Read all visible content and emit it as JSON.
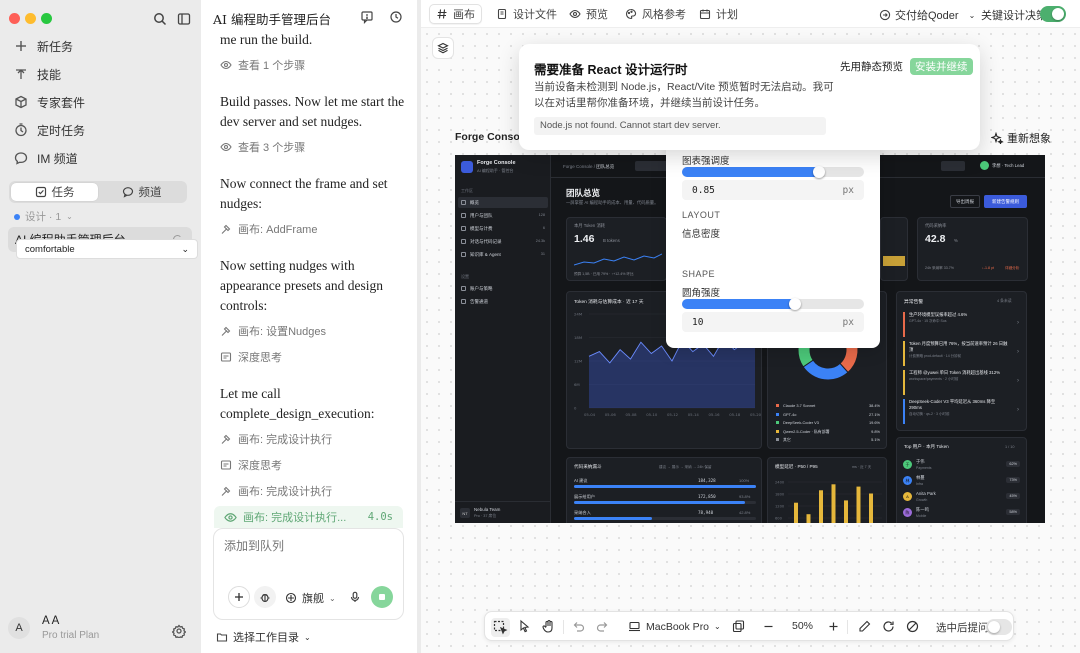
{
  "sidebar": {
    "nav": [
      {
        "label": "新任务",
        "icon": "plus-icon"
      },
      {
        "label": "技能",
        "icon": "tools-icon"
      },
      {
        "label": "专家套件",
        "icon": "package-icon"
      },
      {
        "label": "定时任务",
        "icon": "timer-icon"
      },
      {
        "label": "IM 频道",
        "icon": "chat-bubble-icon"
      }
    ],
    "segments": [
      "任务",
      "频道"
    ],
    "group_label": "设计 · 1",
    "session_title": "AI 编程助手管理后台",
    "user_avatar": "A",
    "user_name": "A A",
    "user_plan": "Pro trial Plan"
  },
  "chat": {
    "title": "AI 编程助手管理后台",
    "items": [
      {
        "type": "text",
        "text": "me run the build."
      },
      {
        "type": "step",
        "icon": "eye-icon",
        "text": "查看 1 个步骤"
      },
      {
        "type": "text",
        "text": "Build passes. Now let me start the dev server and set nudges."
      },
      {
        "type": "step",
        "icon": "eye-icon",
        "text": "查看 3 个步骤"
      },
      {
        "type": "text",
        "text": "Now connect the frame and set nudges:"
      },
      {
        "type": "step",
        "icon": "hammer-icon",
        "text": "画布: AddFrame"
      },
      {
        "type": "text",
        "text": "Now setting nudges with appearance presets and design controls:"
      },
      {
        "type": "step",
        "icon": "hammer-icon",
        "text": "画布: 设置Nudges"
      },
      {
        "type": "step",
        "icon": "thinking-icon",
        "text": "深度思考"
      },
      {
        "type": "text",
        "text": "Let me call complete_design_execution:"
      },
      {
        "type": "step",
        "icon": "hammer-icon",
        "text": "画布: 完成设计执行"
      },
      {
        "type": "step",
        "icon": "thinking-icon",
        "text": "深度思考"
      },
      {
        "type": "step",
        "icon": "hammer-icon",
        "text": "画布: 完成设计执行"
      }
    ],
    "running": {
      "label": "画布: 完成设计执行...",
      "time": "4.0s"
    },
    "composer_placeholder": "添加到队列",
    "model": "旗舰",
    "workspace": "选择工作目录"
  },
  "canvas": {
    "tabs": [
      {
        "label": "画布",
        "icon": "hash-icon",
        "active": true
      },
      {
        "label": "设计文件",
        "icon": "file-icon",
        "active": false
      },
      {
        "label": "预览",
        "icon": "eye-icon",
        "active": false
      },
      {
        "label": "风格参考",
        "icon": "palette-icon",
        "active": false
      },
      {
        "label": "计划",
        "icon": "calendar-icon",
        "active": false
      }
    ],
    "handoff": "交付给Qoder",
    "key_decisions_label": "关键设计决策",
    "key_decisions_on": true,
    "frame_label": "Forge Console",
    "regen_label": "重新想象",
    "accent": "#3b82f6",
    "success": "#4caf6e"
  },
  "alert": {
    "title": "需要准备 React 设计运行时",
    "desc": "当前设备未检测到 Node.js，React/Vite 预览暂时无法启动。我可以在对话里帮你准备环境，并继续当前设计任务。",
    "static_label": "先用静态预览",
    "install_label": "安装并继续",
    "error": "Node.js not found. Cannot start dev server."
  },
  "nudges": {
    "s1_label": "图表强调度",
    "s1_value": "0.85",
    "s1_level": 0.75,
    "layout_section": "LAYOUT",
    "density_label": "信息密度",
    "density_value": "comfortable",
    "shape_section": "SHAPE",
    "radius_label": "圆角强度",
    "radius_value": "10",
    "radius_level": 0.62,
    "unit": "px"
  },
  "dashboard": {
    "brand": "Forge Console",
    "brand_sub": "AI 编程助手 · 管控台",
    "breadcrumb": [
      "Forge Console",
      "团队总览"
    ],
    "user": "李想 · Tech Lead",
    "page_title": "团队总览",
    "page_sub": "一屏掌握 AI 编程助手的成本、用量、代码质量。",
    "btn_export": "导出周报",
    "btn_new": "新建告警规则",
    "sb_nav": [
      {
        "label": "概览",
        "count": ""
      },
      {
        "label": "用户与团队",
        "count": "128"
      },
      {
        "label": "模型与计费",
        "count": "6"
      },
      {
        "label": "对话与代码记录",
        "count": "24.3k"
      },
      {
        "label": "知识库 & Agent",
        "count": "31"
      }
    ],
    "sb_nav2": [
      "账户与策略",
      "告警通道"
    ],
    "sb_group1": "工作区",
    "sb_group2": "设置",
    "team": {
      "name": "Nebula Team",
      "plan": "Pro · 37 席位",
      "avatar": "NT"
    },
    "kpi1": {
      "label": "本月 Token 消耗",
      "value": "1.46",
      "unit": "B tokens",
      "sub": "预算 1,5B · 已用 79% · ↑+12.4% 环比"
    },
    "kpi2": {
      "label": "代码采纳率",
      "value": "42.8",
      "unit": "%",
      "sub": "24h 采纳率 33.7%",
      "delta": "↓-1.8 pt",
      "link": "详细分析"
    },
    "trend": {
      "title": "Token 消耗与估算成本 · 近 17 天",
      "ylabels": [
        "24M",
        "18M",
        "12M",
        "6M",
        "0"
      ],
      "xlabels": [
        "05-04",
        "05-06",
        "05-08",
        "05-10",
        "05-12",
        "05-14",
        "05-16",
        "05-18",
        "05-20"
      ]
    },
    "donut": {
      "legend": [
        {
          "name": "Claude 3.7 Sonnet",
          "pct": "38.4%",
          "color": "#e86a4a"
        },
        {
          "name": "GPT-4o",
          "pct": "27.1%",
          "color": "#3b82f6"
        },
        {
          "name": "DeepSeek-Coder V3",
          "pct": "19.6%",
          "color": "#4cc97a"
        },
        {
          "name": "Qwen2.5-Coder · 私有部署",
          "pct": "9.8%",
          "color": "#e5b73b"
        },
        {
          "name": "其它",
          "pct": "5.1%",
          "color": "#8b8f98"
        }
      ]
    },
    "alerts": {
      "title": "异常告警",
      "count": "4 条未读",
      "items": [
        {
          "t": "生产环境模型误报率超过 4.6%",
          "s": "GPT-4o · 15 次命中 Sus",
          "c": "#e86a4a"
        },
        {
          "t": "Token 月度预算已用 76%，按当前速率预计 26 日触顶",
          "s": "计费策略 prod-default · 14 分钟前",
          "c": "#e5b73b"
        },
        {
          "t": "工程师 @yuwei 单日 Token 消耗超出基线 312%",
          "s": "workspace/payments · 2 小时前",
          "c": "#e5b73b"
        },
        {
          "t": "DeepSeek-Coder V3 平均延迟从 360ms 降至 290ms",
          "s": "自动切换 · qs-2 · 3 小时前",
          "c": "#3b82f6"
        }
      ]
    },
    "top": {
      "title": "Top 用户 · 本月 Token",
      "page": "1 / 10",
      "rows": [
        {
          "n": "于伟",
          "r": "Payments",
          "v": "62%",
          "c": "#4cc97a",
          "a": "于"
        },
        {
          "n": "林蔓",
          "r": "Infra",
          "v": "73%",
          "c": "#3b82f6",
          "a": "林"
        },
        {
          "n": "Anita Park",
          "r": "Growth",
          "v": "45%",
          "c": "#e5b73b",
          "a": "A"
        },
        {
          "n": "陈一鸣",
          "r": "Mobile",
          "v": "58%",
          "c": "#9b6bd9",
          "a": "陈"
        }
      ]
    },
    "funnel": {
      "title": "代码采纳漏斗",
      "filters": "建议 → 展示 → 采纳 → 24h 保留",
      "rows": [
        {
          "label": "AI 建议",
          "value": "184,328",
          "pct": "100%",
          "level": 1.0
        },
        {
          "label": "展示给用户",
          "value": "172,850",
          "pct": "93.8%",
          "level": 0.938
        },
        {
          "label": "采纳合入",
          "value": "78,940",
          "pct": "42.8%",
          "level": 0.428
        }
      ]
    },
    "latency": {
      "title": "模型延迟 · P50 / P95",
      "legend": "ms · 近 7 天",
      "ylabels": [
        "2400",
        "1800",
        "1200",
        "600"
      ],
      "bars": [
        0.55,
        0.3,
        0.82,
        0.95,
        0.6,
        0.9,
        0.75
      ]
    }
  },
  "bottom": {
    "device": "MacBook Pro",
    "zoom": "50%",
    "select_prompt": "选中后提问"
  }
}
